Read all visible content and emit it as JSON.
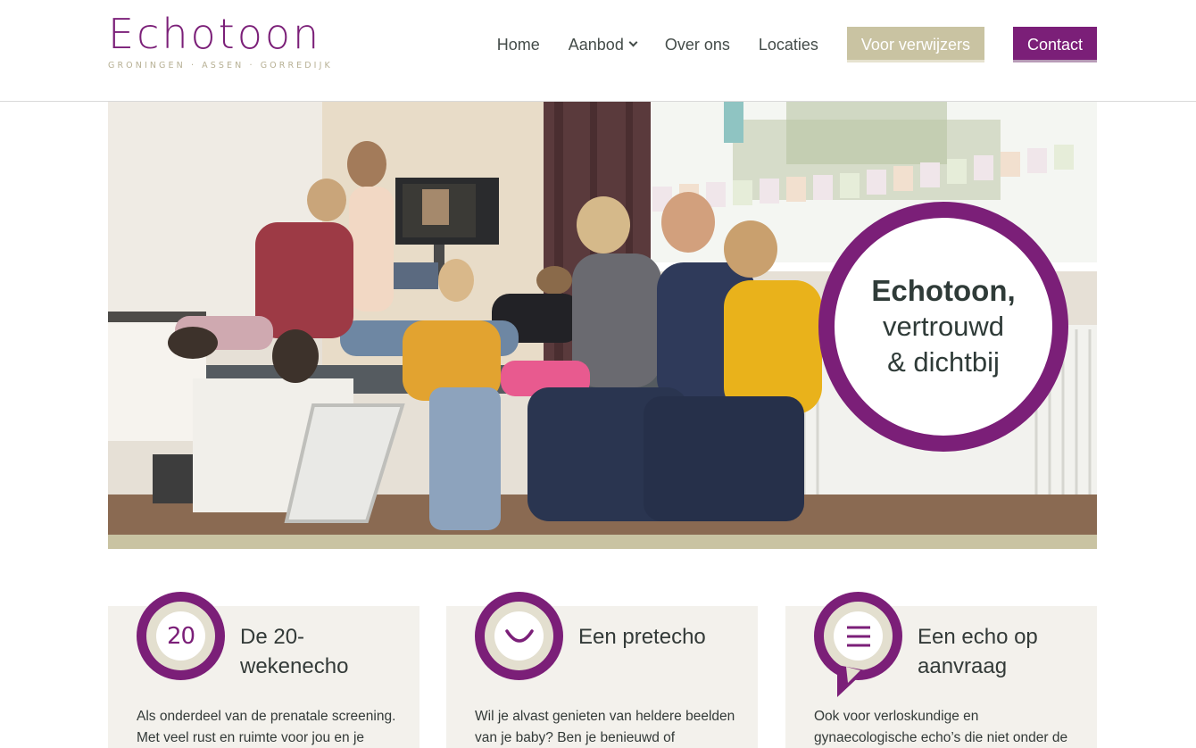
{
  "logo": {
    "word": "Echotoon",
    "subtitle": "GRONINGEN · ASSEN · GORREDIJK"
  },
  "nav": {
    "home": "Home",
    "aanbod": "Aanbod",
    "over_ons": "Over ons",
    "locaties": "Locaties",
    "voor_verwijzers": "Voor verwijzers",
    "contact": "Contact"
  },
  "hero": {
    "title_bold": "Echotoon,",
    "title_line2": "vertrouwd",
    "title_line3": "& dichtbij"
  },
  "cards": [
    {
      "icon": "20-number-icon",
      "icon_text": "20",
      "title": "De 20-wekenecho",
      "text": "Als onderdeel van de prenatale screening. Met veel rust en ruimte voor jou en je"
    },
    {
      "icon": "smile-icon",
      "title": "Een pretecho",
      "text": "Wil je alvast genieten van heldere beelden van je baby? Ben je benieuwd of"
    },
    {
      "icon": "speech-bubble-menu-icon",
      "title": "Een echo op aanvraag",
      "text": "Ook voor verloskundige en gynaecologische echo’s die niet onder de"
    }
  ],
  "colors": {
    "brand_purple": "#7b1f78",
    "beige": "#c9c3a2",
    "card_bg": "#f3f1ec",
    "text": "#333a38"
  }
}
